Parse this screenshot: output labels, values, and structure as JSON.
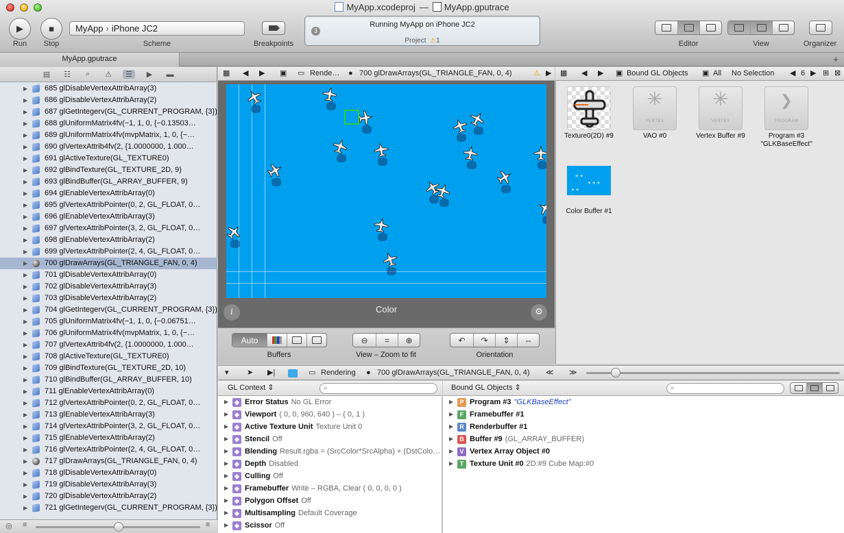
{
  "window": {
    "title_left": "MyApp.xcodeproj",
    "title_sep": "—",
    "title_right": "MyApp.gputrace"
  },
  "toolbar": {
    "run_label": "Run",
    "stop_label": "Stop",
    "scheme_app": "MyApp",
    "scheme_device": "iPhone JC2",
    "scheme_label": "Scheme",
    "breakpoints_label": "Breakpoints",
    "activity_status": "Running MyApp on iPhone JC2",
    "activity_project": "Project",
    "activity_warnings": "1",
    "activity_count": "3",
    "editor_label": "Editor",
    "view_label": "View",
    "organizer_label": "Organizer"
  },
  "tab": {
    "title": "MyApp.gputrace",
    "add": "+"
  },
  "calls": [
    "685 glDisableVertexAttribArray(3)",
    "686 glDisableVertexAttribArray(2)",
    "687 glGetIntegerv(GL_CURRENT_PROGRAM, {3})",
    "688 glUniformMatrix4fv(−1, 1, 0, {−0.13503…",
    "689 glUniformMatrix4fv(mvpMatrix, 1, 0, {−…",
    "690 glVertexAttrib4fv(2, {1.0000000, 1.000…",
    "691 glActiveTexture(GL_TEXTURE0)",
    "692 glBindTexture(GL_TEXTURE_2D, 9)",
    "693 glBindBuffer(GL_ARRAY_BUFFER, 9)",
    "694 glEnableVertexAttribArray(0)",
    "695 glVertexAttribPointer(0, 2, GL_FLOAT, 0…",
    "696 glEnableVertexAttribArray(3)",
    "697 glVertexAttribPointer(3, 2, GL_FLOAT, 0…",
    "698 glEnableVertexAttribArray(2)",
    "699 glVertexAttribPointer(2, 4, GL_FLOAT, 0…",
    "700 glDrawArrays(GL_TRIANGLE_FAN, 0, 4)",
    "701 glDisableVertexAttribArray(0)",
    "702 glDisableVertexAttribArray(3)",
    "703 glDisableVertexAttribArray(2)",
    "704 glGetIntegerv(GL_CURRENT_PROGRAM, {3})",
    "705 glUniformMatrix4fv(−1, 1, 0, {−0.06751…",
    "706 glUniformMatrix4fv(mvpMatrix, 1, 0, {−…",
    "707 glVertexAttrib4fv(2, {1.0000000, 1.000…",
    "708 glActiveTexture(GL_TEXTURE0)",
    "709 glBindTexture(GL_TEXTURE_2D, 10)",
    "710 glBindBuffer(GL_ARRAY_BUFFER, 10)",
    "711 glEnableVertexAttribArray(0)",
    "712 glVertexAttribPointer(0, 2, GL_FLOAT, 0…",
    "713 glEnableVertexAttribArray(3)",
    "714 glVertexAttribPointer(3, 2, GL_FLOAT, 0…",
    "715 glEnableVertexAttribArray(2)",
    "716 glVertexAttribPointer(2, 4, GL_FLOAT, 0…",
    "717 glDrawArrays(GL_TRIANGLE_FAN, 0, 4)",
    "718 glDisableVertexAttribArray(0)",
    "719 glDisableVertexAttribArray(3)",
    "720 glDisableVertexAttribArray(2)",
    "721 glGetIntegerv(GL_CURRENT_PROGRAM, {3})"
  ],
  "selected_call_index": 15,
  "draw_call_indices": [
    15,
    32
  ],
  "frame_jump": {
    "crumb1": "Rende…",
    "crumb2": "700 glDrawArrays(GL_TRIANGLE_FAN, 0, 4)"
  },
  "frame": {
    "caption": "Color",
    "info": "i",
    "gear": "⚙",
    "buffers_auto": "Auto",
    "buffers_label": "Buffers",
    "zoom_label": "View – Zoom to fit",
    "orientation_label": "Orientation"
  },
  "resources_jump": {
    "crumb1": "Bound GL Objects",
    "crumb2": "All",
    "crumb3": "No Selection",
    "count": "6"
  },
  "resources": [
    {
      "label": "Texture0(2D) #9",
      "kind": "texture"
    },
    {
      "label": "VAO #0",
      "kind": "vertex",
      "tag": "VERTEX"
    },
    {
      "label": "Vertex Buffer #9",
      "kind": "vertex",
      "tag": "VERTEX"
    },
    {
      "label": "Program #3",
      "label2": "\"GLKBaseEffect\"",
      "kind": "program",
      "tag": "PROGRAM"
    },
    {
      "label": "Color Buffer #1",
      "kind": "color"
    }
  ],
  "debug_jump": {
    "crumb1": "Rendering",
    "crumb2": "700 glDrawArrays(GL_TRIANGLE_FAN, 0, 4)"
  },
  "gl_context": {
    "header": "GL Context",
    "rows": [
      {
        "key": "Error Status",
        "val": "No GL Error"
      },
      {
        "key": "Viewport",
        "val": "( 0, 0, 960, 640 ) – ( 0, 1 )"
      },
      {
        "key": "Active Texture Unit",
        "val": "Texture Unit 0"
      },
      {
        "key": "Stencil",
        "val": "Off"
      },
      {
        "key": "Blending",
        "val": "Result.rgba = (SrcColor*SrcAlpha) + (DstColo…"
      },
      {
        "key": "Depth",
        "val": "Disabled"
      },
      {
        "key": "Culling",
        "val": "Off"
      },
      {
        "key": "Framebuffer",
        "val": "Write – RGBA, Clear ( 0, 0, 0, 0 )"
      },
      {
        "key": "Polygon Offset",
        "val": "Off"
      },
      {
        "key": "Multisampling",
        "val": "Default Coverage"
      },
      {
        "key": "Scissor",
        "val": "Off"
      }
    ]
  },
  "bound_objects": {
    "header": "Bound GL Objects",
    "rows": [
      {
        "badge": "P",
        "color": "#e39a4e",
        "key": "Program #3",
        "val": "\"GLKBaseEffect\"",
        "blue": true
      },
      {
        "badge": "F",
        "color": "#5aa663",
        "key": "Framebuffer #1",
        "val": ""
      },
      {
        "badge": "R",
        "color": "#5d86c4",
        "key": "Renderbuffer #1",
        "val": ""
      },
      {
        "badge": "B",
        "color": "#d9534f",
        "key": "Buffer #9",
        "val": "(GL_ARRAY_BUFFER)"
      },
      {
        "badge": "V",
        "color": "#8d6bbf",
        "key": "Vertex Array Object #0",
        "val": ""
      },
      {
        "badge": "T",
        "color": "#5aa663",
        "key": "Texture Unit #0",
        "val": "2D:#9   Cube Map:#0"
      }
    ]
  },
  "colors": {
    "frame_blue": "#00a0ee",
    "selection": "#a8b7d0",
    "warning": "#f2b90f"
  }
}
